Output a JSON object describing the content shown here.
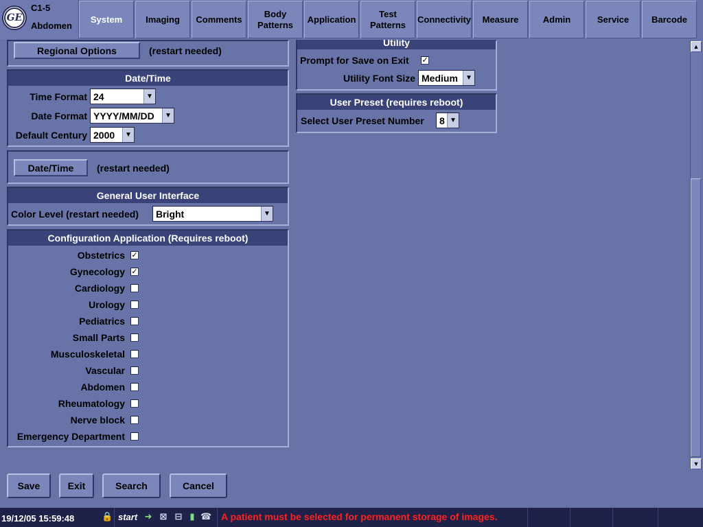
{
  "header": {
    "probe": "C1-5",
    "preset": "Abdomen",
    "logo_text": "GE"
  },
  "tabs": [
    {
      "label": "System"
    },
    {
      "label": "Imaging"
    },
    {
      "label": "Comments"
    },
    {
      "label": "Body\nPatterns"
    },
    {
      "label": "Application"
    },
    {
      "label": "Test\nPatterns"
    },
    {
      "label": "Connectivity"
    },
    {
      "label": "Measure"
    },
    {
      "label": "Admin"
    },
    {
      "label": "Service"
    },
    {
      "label": "Barcode"
    }
  ],
  "active_tab": "System",
  "regional": {
    "button": "Regional Options",
    "note": "(restart needed)"
  },
  "datetime_panel": {
    "title": "Date/Time",
    "time_format_label": "Time Format",
    "time_format_value": "24",
    "date_format_label": "Date Format",
    "date_format_value": "YYYY/MM/DD",
    "century_label": "Default Century",
    "century_value": "2000"
  },
  "datetime_button": {
    "button": "Date/Time",
    "note": "(restart needed)"
  },
  "gui_panel": {
    "title": "General User Interface",
    "color_label": "Color Level (restart needed)",
    "color_value": "Bright"
  },
  "config_panel": {
    "title": "Configuration Application (Requires reboot)",
    "items": [
      {
        "label": "Obstetrics",
        "checked": true
      },
      {
        "label": "Gynecology",
        "checked": true
      },
      {
        "label": "Cardiology",
        "checked": false
      },
      {
        "label": "Urology",
        "checked": false
      },
      {
        "label": "Pediatrics",
        "checked": false
      },
      {
        "label": "Small Parts",
        "checked": false
      },
      {
        "label": "Musculoskeletal",
        "checked": false
      },
      {
        "label": "Vascular",
        "checked": false
      },
      {
        "label": "Abdomen",
        "checked": false
      },
      {
        "label": "Rheumatology",
        "checked": false
      },
      {
        "label": "Nerve block",
        "checked": false
      },
      {
        "label": "Emergency Department",
        "checked": false
      }
    ]
  },
  "utility_panel": {
    "title": "Utility",
    "prompt_label": "Prompt for Save on Exit",
    "prompt_checked": true,
    "font_label": "Utility Font Size",
    "font_value": "Medium"
  },
  "user_preset_panel": {
    "title": "User Preset (requires reboot)",
    "select_label": "Select User Preset Number",
    "select_value": "8"
  },
  "footer_buttons": {
    "save": "Save",
    "exit": "Exit",
    "search": "Search",
    "cancel": "Cancel"
  },
  "statusbar": {
    "datetime": "19/12/05 15:59:48",
    "start": "start",
    "message": "A patient must be selected for permanent storage of images.",
    "message_color": "#ff2020"
  },
  "colors": {
    "background": "#6874a8",
    "panel_header": "#3a4378",
    "statusbar": "#1e2248"
  }
}
